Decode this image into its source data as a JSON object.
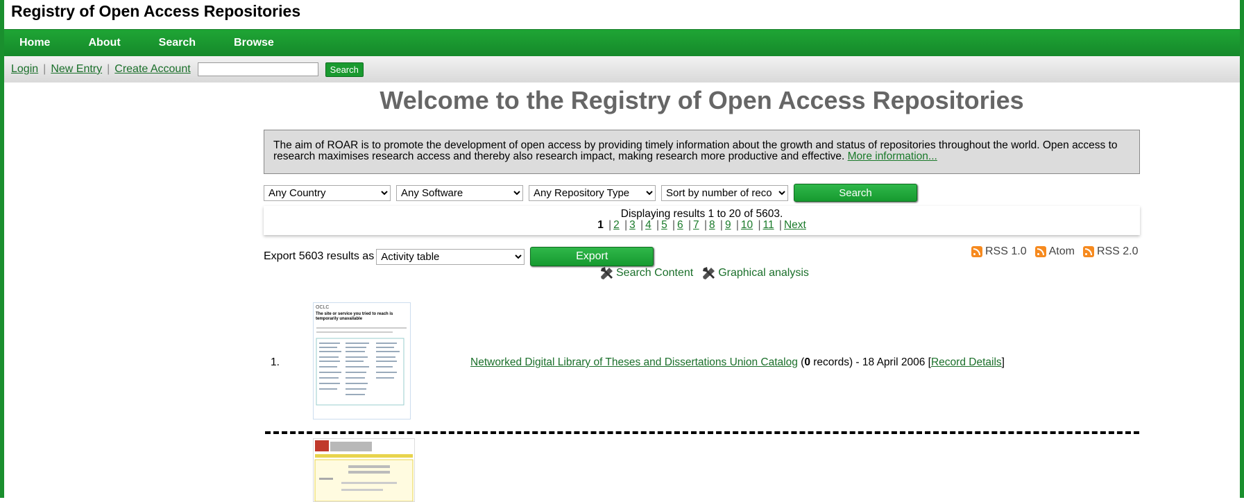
{
  "site": {
    "title": "Registry of Open Access Repositories"
  },
  "main_nav": [
    {
      "label": "Home"
    },
    {
      "label": "About"
    },
    {
      "label": "Search"
    },
    {
      "label": "Browse"
    }
  ],
  "sub_bar": {
    "links": [
      "Login",
      "New Entry",
      "Create Account"
    ],
    "search_value": "",
    "search_button": "Search"
  },
  "welcome": {
    "heading": "Welcome to the Registry of Open Access Repositories"
  },
  "intro": {
    "text": "The aim of ROAR is to promote the development of open access by providing timely information about the growth and status of repositories throughout the world. Open access to research maximises research access and thereby also research impact, making research more productive and effective. ",
    "more_link": "More information..."
  },
  "filters": {
    "country": "Any Country",
    "software": "Any Software",
    "repository_type": "Any Repository Type",
    "sort": "Sort by number of reco",
    "search_button": "Search"
  },
  "results": {
    "summary": "Displaying results 1 to 20 of 5603.",
    "current_page": "1",
    "pages": [
      "2",
      "3",
      "4",
      "5",
      "6",
      "7",
      "8",
      "9",
      "10",
      "11"
    ],
    "next": "Next"
  },
  "export": {
    "label": "Export 5603 results as",
    "format": "Activity table",
    "button": "Export"
  },
  "feeds": [
    {
      "label": "RSS 1.0",
      "icon": "rss-icon"
    },
    {
      "label": "Atom",
      "icon": "rss-icon"
    },
    {
      "label": "RSS 2.0",
      "icon": "rss-icon"
    }
  ],
  "tools": [
    {
      "label": "Search Content",
      "icon": "wrench-icon"
    },
    {
      "label": "Graphical analysis",
      "icon": "wrench-icon"
    }
  ],
  "entries": [
    {
      "number": "1.",
      "title": "Networked Digital Library of Theses and Dissertations Union Catalog",
      "records_open": "(",
      "records_count": "0",
      "records_rest": " records) - 18 April 2006 [",
      "details_link": "Record Details",
      "close": "]",
      "thumb_logo": "OCLC",
      "thumb_heading": "The site or service you tried to reach is temporarily unavailable"
    }
  ],
  "colors": {
    "nav_green": "#1a9a30",
    "link_green": "#1a6f2a",
    "heading_gray": "#666666",
    "intro_bg": "#dcdcdc",
    "rss_orange": "#f68a1f"
  }
}
